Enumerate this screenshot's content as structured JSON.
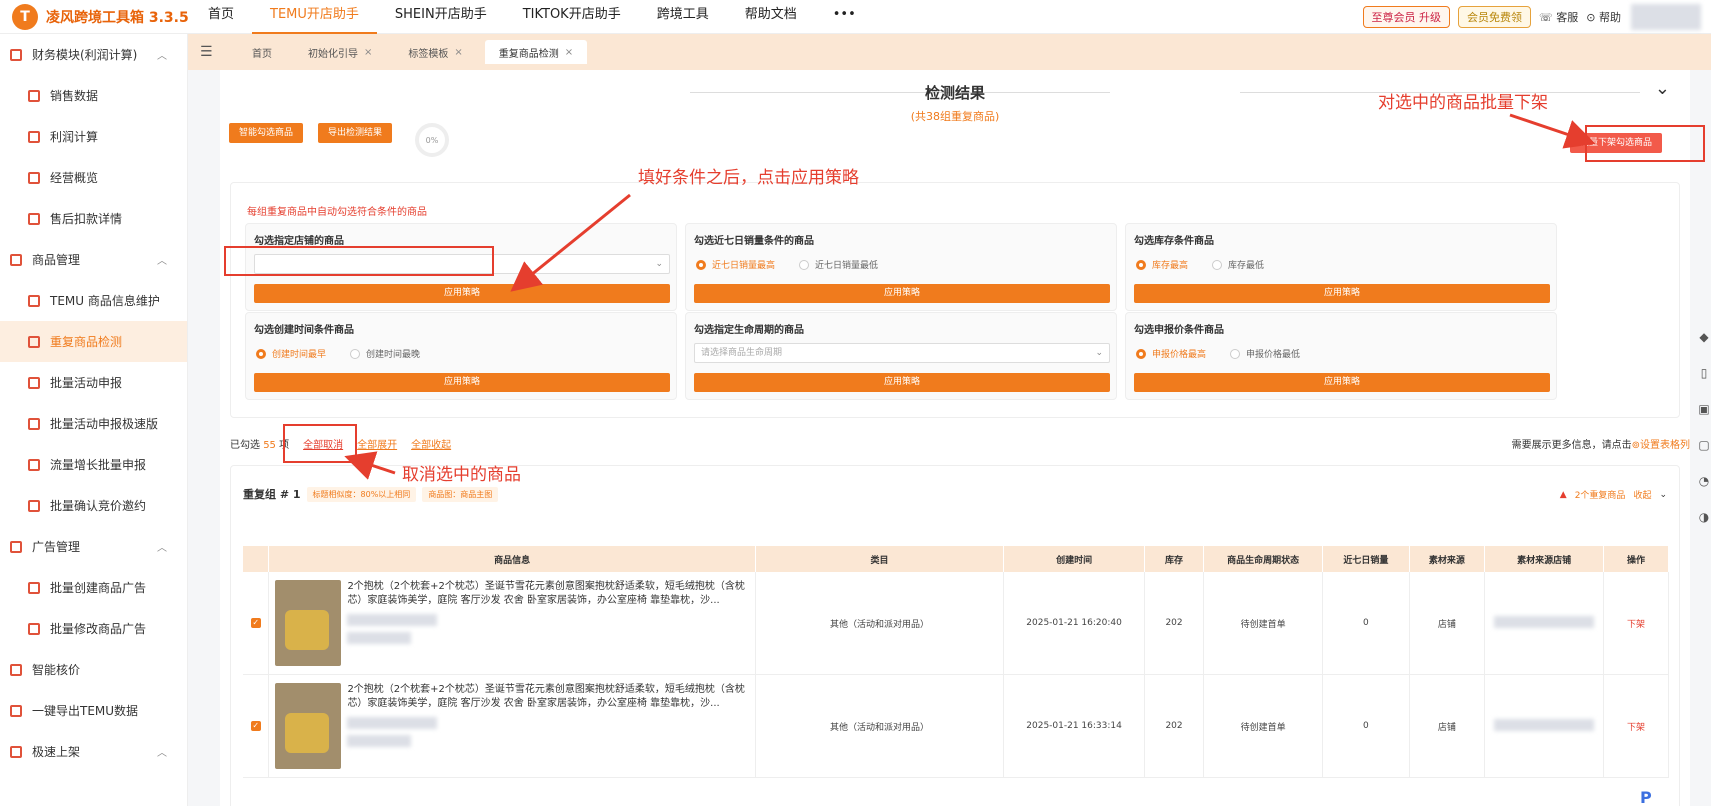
{
  "app": {
    "title": "凌风跨境工具箱 3.3.5",
    "logo_letter": "T"
  },
  "topnav": [
    "首页",
    "TEMU开店助手",
    "SHEIN开店助手",
    "TIKTOK开店助手",
    "跨境工具",
    "帮助文档",
    "•••"
  ],
  "topright": {
    "vip": "至尊会员 升级",
    "member": "会员免费领",
    "service": "客服",
    "help": "帮助"
  },
  "sidebar": [
    {
      "type": "group",
      "label": "财务模块(利润计算)"
    },
    {
      "type": "child",
      "label": "销售数据"
    },
    {
      "type": "child",
      "label": "利润计算"
    },
    {
      "type": "child",
      "label": "经营概览"
    },
    {
      "type": "child",
      "label": "售后扣款详情"
    },
    {
      "type": "group",
      "label": "商品管理"
    },
    {
      "type": "child",
      "label": "TEMU 商品信息维护"
    },
    {
      "type": "child",
      "label": "重复商品检测"
    },
    {
      "type": "child",
      "label": "批量活动申报"
    },
    {
      "type": "child",
      "label": "批量活动申报极速版"
    },
    {
      "type": "child",
      "label": "流量增长批量申报"
    },
    {
      "type": "child",
      "label": "批量确认竞价邀约"
    },
    {
      "type": "group",
      "label": "广告管理"
    },
    {
      "type": "child",
      "label": "批量创建商品广告"
    },
    {
      "type": "child",
      "label": "批量修改商品广告"
    },
    {
      "type": "group",
      "label": "智能核价"
    },
    {
      "type": "group",
      "label": "一键导出TEMU数据"
    },
    {
      "type": "group",
      "label": "极速上架"
    }
  ],
  "tabs": [
    "首页",
    "初始化引导",
    "标签模板",
    "重复商品检测"
  ],
  "result": {
    "title": "检测结果",
    "subtitle": "(共38组重复商品)",
    "btn_smart": "智能勾选商品",
    "btn_export": "导出检测结果",
    "progress": "0%",
    "btn_batch_off": "批量下架勾选商品"
  },
  "strategy": {
    "hint": "每组重复商品中自动勾选符合条件的商品",
    "apply": "应用策略",
    "cards": [
      {
        "title": "勾选指定店铺的商品",
        "kind": "select",
        "placeholder": ""
      },
      {
        "title": "勾选近七日销量条件的商品",
        "kind": "radio",
        "options": [
          "近七日销量最高",
          "近七日销量最低"
        ]
      },
      {
        "title": "勾选库存条件商品",
        "kind": "radio",
        "options": [
          "库存最高",
          "库存最低"
        ]
      },
      {
        "title": "勾选创建时间条件商品",
        "kind": "radio",
        "options": [
          "创建时间最早",
          "创建时间最晚"
        ]
      },
      {
        "title": "勾选指定生命周期的商品",
        "kind": "select",
        "placeholder": "请选择商品生命周期"
      },
      {
        "title": "勾选申报价条件商品",
        "kind": "radio",
        "options": [
          "申报价格最高",
          "申报价格最低"
        ]
      }
    ]
  },
  "selbar": {
    "prefix": "已勾选",
    "count": "55",
    "suffix": "项",
    "cancel_all": "全部取消",
    "expand_all": "全部展开",
    "collapse_all": "全部收起"
  },
  "more_info": {
    "text": "需要展示更多信息，请点击",
    "link": "设置表格列"
  },
  "group": {
    "title": "重复组 # 1",
    "tag1": "标题相似度：80%以上相同",
    "tag2": "商品图：商品主图",
    "right_count": "2个重复商品",
    "right_fold": "收起"
  },
  "table": {
    "headers": [
      "",
      "商品信息",
      "类目",
      "创建时间",
      "库存",
      "商品生命周期状态",
      "近七日销量",
      "素材来源",
      "素材来源店铺",
      "操作"
    ],
    "rows": [
      {
        "title": "2个抱枕（2个枕套+2个枕芯）圣诞节雪花元素创意图案抱枕舒适柔软，短毛绒抱枕（含枕芯）家庭装饰美学，庭院 客厅沙发 农舍 卧室家居装饰，办公室座椅 靠垫靠枕，沙...",
        "category": "其他（活动和派对用品）",
        "created": "2025-01-21 16:20:40",
        "stock": "202",
        "status": "待创建首单",
        "sales": "0",
        "source": "店铺",
        "action": "下架"
      },
      {
        "title": "2个抱枕（2个枕套+2个枕芯）圣诞节雪花元素创意图案抱枕舒适柔软，短毛绒抱枕（含枕芯）家庭装饰美学，庭院 客厅沙发 农舍 卧室家居装饰，办公室座椅 靠垫靠枕，沙...",
        "category": "其他（活动和派对用品）",
        "created": "2025-01-21 16:33:14",
        "stock": "202",
        "status": "待创建首单",
        "sales": "0",
        "source": "店铺",
        "action": "下架"
      }
    ]
  },
  "annotations": {
    "batch_off": "对选中的商品批量下架",
    "apply": "填好条件之后，点击应用策略",
    "cancel": "取消选中的商品"
  },
  "colors": {
    "accent": "#f07b1d",
    "red": "#e53e2e",
    "tab_bg": "#fbe7d4"
  }
}
